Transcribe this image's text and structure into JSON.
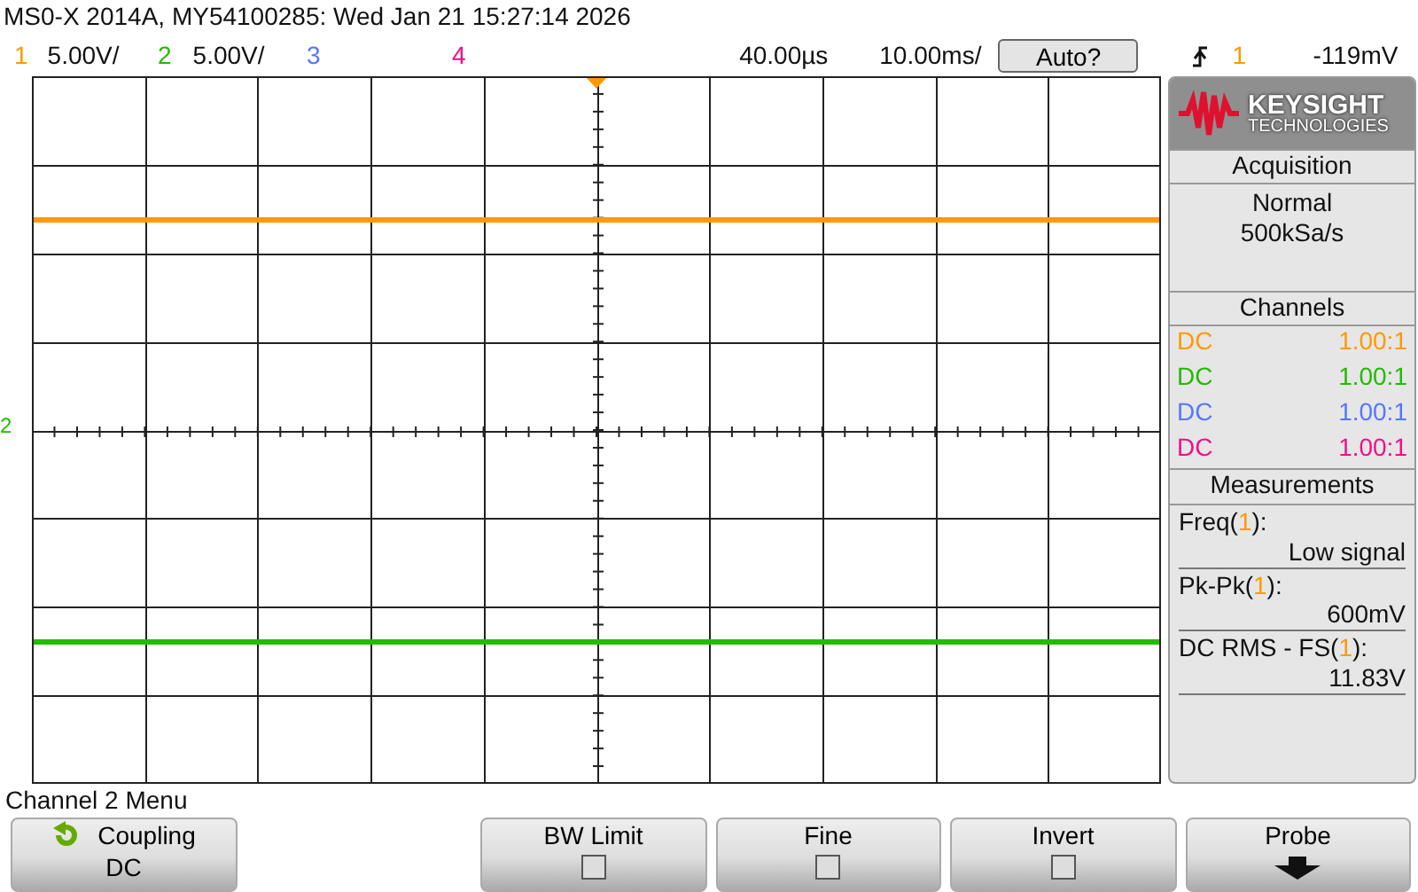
{
  "window": {
    "title": "MS0-X 2014A, MY54100285: Wed Jan 21 15:27:14 2026"
  },
  "channels": [
    {
      "number": "1",
      "scale": "5.00V/",
      "color": "#ff9900",
      "coupling": "DC",
      "probe": "1.00:1"
    },
    {
      "number": "2",
      "scale": "5.00V/",
      "color": "#22bb00",
      "coupling": "DC",
      "probe": "1.00:1"
    },
    {
      "number": "3",
      "color": "#5577ff",
      "coupling": "DC",
      "probe": "1.00:1"
    },
    {
      "number": "4",
      "color": "#ee1188",
      "coupling": "DC",
      "probe": "1.00:1"
    }
  ],
  "timebase": {
    "delay": "40.00µs",
    "scale": "10.00ms/"
  },
  "auto_button": "Auto?",
  "trigger": {
    "source": "1",
    "level": "-119mV"
  },
  "ground_marker": "2",
  "logo": {
    "name": "KEYSIGHT",
    "subtitle": "TECHNOLOGIES"
  },
  "acquisition": {
    "title": "Acquisition",
    "mode": "Normal",
    "rate": "500kSa/s"
  },
  "channels_panel": {
    "title": "Channels"
  },
  "measurements": {
    "title": "Measurements",
    "items": [
      {
        "prefix": "Freq(",
        "source": "1",
        "suffix": "):",
        "value": "Low signal"
      },
      {
        "prefix": "Pk-Pk(",
        "source": "1",
        "suffix": "):",
        "value": "600mV"
      },
      {
        "prefix": "DC RMS - FS(",
        "source": "1",
        "suffix": "):",
        "value": "11.83V"
      }
    ]
  },
  "menu": {
    "title": "Channel 2 Menu",
    "softkeys": [
      {
        "kind": "value",
        "label": "Coupling",
        "value": "DC"
      },
      {
        "kind": "empty"
      },
      {
        "kind": "checkbox",
        "label": "BW Limit",
        "checked": false
      },
      {
        "kind": "checkbox",
        "label": "Fine",
        "checked": false
      },
      {
        "kind": "checkbox",
        "label": "Invert",
        "checked": false
      },
      {
        "kind": "submenu",
        "label": "Probe"
      }
    ]
  }
}
